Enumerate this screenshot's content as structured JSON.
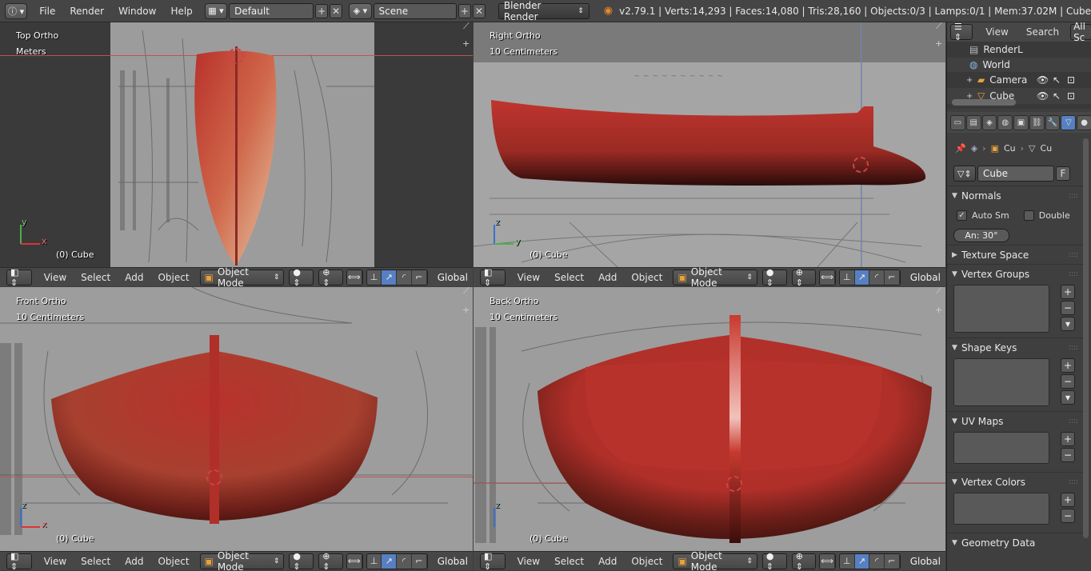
{
  "topbar": {
    "menus": [
      "File",
      "Render",
      "Window",
      "Help"
    ],
    "layout": "Default",
    "scene": "Scene",
    "engine": "Blender Render",
    "stats": "v2.79.1 | Verts:14,293 | Faces:14,080 | Tris:28,160 | Objects:0/3 | Lamps:0/1 | Mem:37.02M | Cube"
  },
  "viewports": [
    {
      "title": "Top Ortho",
      "units": "Meters",
      "object": "(0) Cube",
      "axis_v": "y",
      "axis_h": "x"
    },
    {
      "title": "Right Ortho",
      "units": "10 Centimeters",
      "object": "(0) Cube",
      "axis_v": "z",
      "axis_h": "y"
    },
    {
      "title": "Front Ortho",
      "units": "10 Centimeters",
      "object": "(0) Cube",
      "axis_v": "z",
      "axis_h": "x"
    },
    {
      "title": "Back Ortho",
      "units": "10 Centimeters",
      "object": "(0) Cube",
      "axis_v": "z",
      "axis_h": ""
    }
  ],
  "vp_header": {
    "menus": [
      "View",
      "Select",
      "Add",
      "Object"
    ],
    "mode": "Object Mode",
    "orientation": "Global"
  },
  "outliner": {
    "view": "View",
    "search": "Search",
    "scope": "All Sc",
    "items": [
      "RenderL",
      "World",
      "Camera",
      "Cube"
    ]
  },
  "properties": {
    "breadcrumb_a": "Cu",
    "breadcrumb_b": "Cu",
    "datablock": "Cube",
    "fake_user": "F",
    "panels": {
      "normals": "Normals",
      "auto_smooth": "Auto Sm",
      "double": "Double",
      "angle": "An: 30°",
      "texture_space": "Texture Space",
      "vertex_groups": "Vertex Groups",
      "shape_keys": "Shape Keys",
      "uv_maps": "UV Maps",
      "vertex_colors": "Vertex Colors",
      "geometry_data": "Geometry Data"
    }
  },
  "colors": {
    "hull_red": "#b8322c",
    "selection_blue": "#5680c2",
    "header_bg": "#474747"
  }
}
